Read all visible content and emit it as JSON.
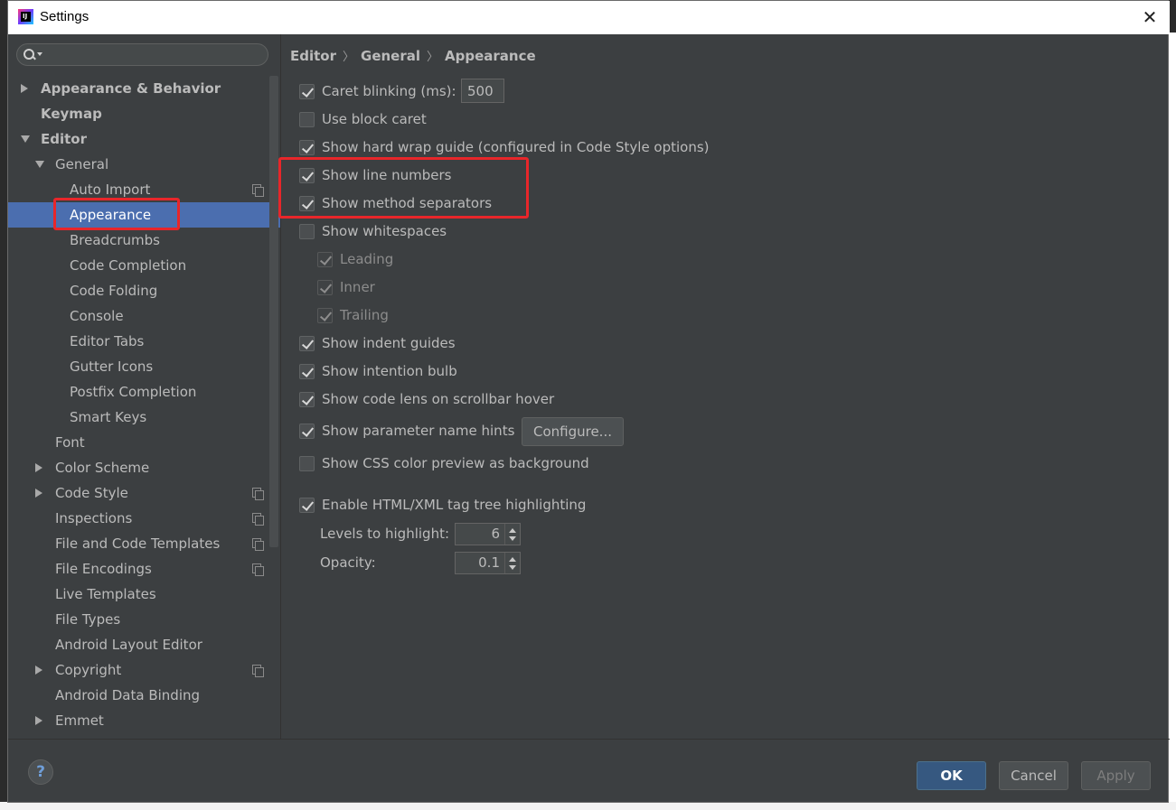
{
  "window": {
    "title": "Settings"
  },
  "search": {
    "placeholder": "",
    "value": ""
  },
  "tree": [
    {
      "label": "Appearance & Behavior",
      "level": 0,
      "arrow": "right",
      "bold": true
    },
    {
      "label": "Keymap",
      "level": 0,
      "arrow": "none",
      "bold": true
    },
    {
      "label": "Editor",
      "level": 0,
      "arrow": "down",
      "bold": true
    },
    {
      "label": "General",
      "level": 1,
      "arrow": "down"
    },
    {
      "label": "Auto Import",
      "level": 2,
      "arrow": "none",
      "copy": true
    },
    {
      "label": "Appearance",
      "level": 2,
      "arrow": "none",
      "selected": true
    },
    {
      "label": "Breadcrumbs",
      "level": 2,
      "arrow": "none"
    },
    {
      "label": "Code Completion",
      "level": 2,
      "arrow": "none"
    },
    {
      "label": "Code Folding",
      "level": 2,
      "arrow": "none"
    },
    {
      "label": "Console",
      "level": 2,
      "arrow": "none"
    },
    {
      "label": "Editor Tabs",
      "level": 2,
      "arrow": "none"
    },
    {
      "label": "Gutter Icons",
      "level": 2,
      "arrow": "none"
    },
    {
      "label": "Postfix Completion",
      "level": 2,
      "arrow": "none"
    },
    {
      "label": "Smart Keys",
      "level": 2,
      "arrow": "none"
    },
    {
      "label": "Font",
      "level": 1,
      "arrow": "none"
    },
    {
      "label": "Color Scheme",
      "level": 1,
      "arrow": "right"
    },
    {
      "label": "Code Style",
      "level": 1,
      "arrow": "right",
      "copy": true
    },
    {
      "label": "Inspections",
      "level": 1,
      "arrow": "none",
      "copy": true
    },
    {
      "label": "File and Code Templates",
      "level": 1,
      "arrow": "none",
      "copy": true
    },
    {
      "label": "File Encodings",
      "level": 1,
      "arrow": "none",
      "copy": true
    },
    {
      "label": "Live Templates",
      "level": 1,
      "arrow": "none"
    },
    {
      "label": "File Types",
      "level": 1,
      "arrow": "none"
    },
    {
      "label": "Android Layout Editor",
      "level": 1,
      "arrow": "none"
    },
    {
      "label": "Copyright",
      "level": 1,
      "arrow": "right",
      "copy": true
    },
    {
      "label": "Android Data Binding",
      "level": 1,
      "arrow": "none"
    },
    {
      "label": "Emmet",
      "level": 1,
      "arrow": "right"
    }
  ],
  "breadcrumb": {
    "part1": "Editor",
    "part2": "General",
    "part3": "Appearance",
    "separator": "〉"
  },
  "options": {
    "caret_blinking": {
      "label": "Caret blinking (ms):",
      "checked": true,
      "value": "500"
    },
    "block_caret": {
      "label": "Use block caret",
      "checked": false
    },
    "hard_wrap": {
      "label": "Show hard wrap guide (configured in Code Style options)",
      "checked": true
    },
    "line_numbers": {
      "label": "Show line numbers",
      "checked": true
    },
    "method_separators": {
      "label": "Show method separators",
      "checked": true
    },
    "whitespaces": {
      "label": "Show whitespaces",
      "checked": false
    },
    "leading": {
      "label": "Leading",
      "checked": true,
      "disabled": true
    },
    "inner": {
      "label": "Inner",
      "checked": true,
      "disabled": true
    },
    "trailing": {
      "label": "Trailing",
      "checked": true,
      "disabled": true
    },
    "indent_guides": {
      "label": "Show indent guides",
      "checked": true
    },
    "intention_bulb": {
      "label": "Show intention bulb",
      "checked": true
    },
    "code_lens": {
      "label": "Show code lens on scrollbar hover",
      "checked": true
    },
    "param_hints": {
      "label": "Show parameter name hints",
      "checked": true,
      "button": "Configure..."
    },
    "css_color": {
      "label": "Show CSS color preview as background",
      "checked": false
    },
    "tag_tree": {
      "label": "Enable HTML/XML tag tree highlighting",
      "checked": true
    },
    "levels": {
      "label": "Levels to highlight:",
      "value": "6"
    },
    "opacity": {
      "label": "Opacity:",
      "value": "0.1"
    }
  },
  "footer": {
    "help": "?",
    "ok": "OK",
    "cancel": "Cancel",
    "apply": "Apply"
  },
  "colors": {
    "background": "#3c3f41",
    "selection": "#4b6eaf",
    "highlight": "#e8262a",
    "ok_button": "#365880"
  }
}
